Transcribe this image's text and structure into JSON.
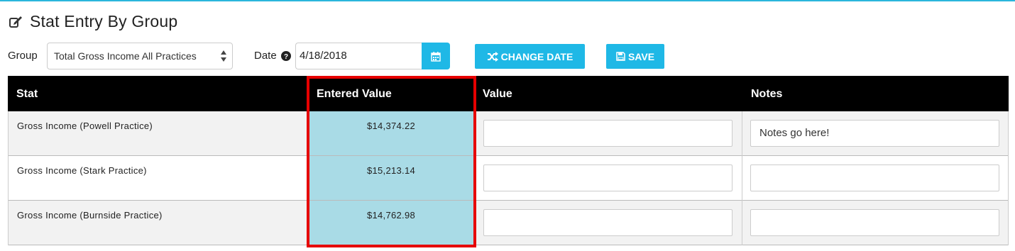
{
  "page": {
    "title": "Stat Entry By Group"
  },
  "controls": {
    "group_label": "Group",
    "group_value": "Total Gross Income All Practices",
    "date_label": "Date",
    "date_value": "4/18/2018",
    "change_date_label": "CHANGE DATE",
    "save_label": "SAVE"
  },
  "table": {
    "headers": [
      "Stat",
      "Entered Value",
      "Value",
      "Notes"
    ],
    "rows": [
      {
        "stat": "Gross Income (Powell Practice)",
        "entered": "$14,374.22",
        "value": "",
        "notes": "Notes go here!"
      },
      {
        "stat": "Gross Income (Stark Practice)",
        "entered": "$15,213.14",
        "value": "",
        "notes": ""
      },
      {
        "stat": "Gross Income (Burnside Practice)",
        "entered": "$14,762.98",
        "value": "",
        "notes": ""
      }
    ]
  },
  "icons": {
    "title": "edit-icon",
    "help": "question-circle-icon",
    "calendar": "calendar-icon",
    "change_date": "shuffle-icon",
    "save": "floppy-disk-icon"
  },
  "colors": {
    "accent": "#1fb8e6",
    "header_bg": "#000000",
    "entered_bg": "#a9dbe6",
    "highlight": "#e60000"
  }
}
